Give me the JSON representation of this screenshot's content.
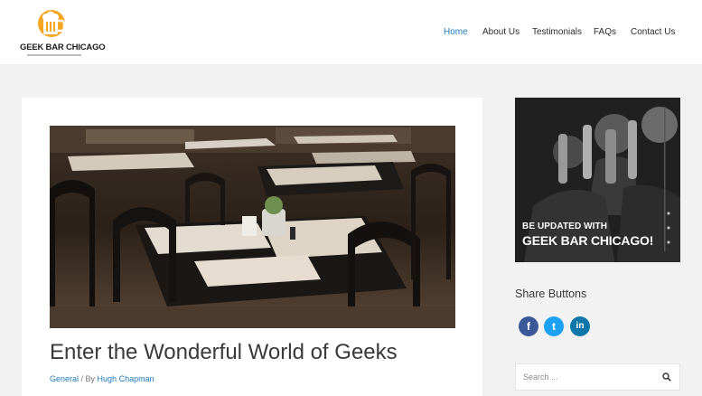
{
  "header": {
    "logo_name": "GEEK BAR CHICAGO",
    "nav": [
      {
        "label": "Home",
        "active": true
      },
      {
        "label": "About Us",
        "active": false
      },
      {
        "label": "Testimonials",
        "active": false
      },
      {
        "label": "FAQs",
        "active": false
      },
      {
        "label": "Contact Us",
        "active": false
      }
    ]
  },
  "post": {
    "title": "Enter the Wonderful World of Geeks",
    "category": "General",
    "meta_sep": " / By ",
    "author": "Hugh Chapman"
  },
  "sidebar": {
    "promo_line1": "BE UPDATED WITH",
    "promo_line2": "GEEK BAR CHICAGO!",
    "share_heading": "Share Buttons",
    "social": [
      {
        "icon": "facebook-icon",
        "glyph": "f",
        "color": "#3b5998"
      },
      {
        "icon": "twitter-icon",
        "glyph": "t",
        "color": "#1da1f2"
      },
      {
        "icon": "linkedin-icon",
        "glyph": "in",
        "color": "#0e76a8"
      }
    ],
    "search_placeholder": "Search ..."
  },
  "colors": {
    "accent": "#1f7ab7",
    "logo_orange": "#f5a623",
    "page_bg": "#f2f2f2"
  }
}
